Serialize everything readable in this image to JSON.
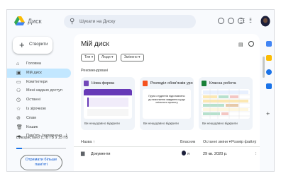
{
  "header": {
    "app_name": "Диск",
    "search_placeholder": "Шукати на Диску"
  },
  "sidebar": {
    "new_label": "Створити",
    "items": [
      {
        "label": "Головна",
        "icon": "home-icon",
        "glyph": "⌂"
      },
      {
        "label": "Мій диск",
        "icon": "my-drive-icon",
        "glyph": "▣"
      },
      {
        "label": "Комп'ютери",
        "icon": "computer-icon",
        "glyph": "▭"
      },
      {
        "label": "Мені надано доступ",
        "icon": "shared-icon",
        "glyph": "⚇"
      },
      {
        "label": "Останні",
        "icon": "clock-icon",
        "glyph": "◷"
      },
      {
        "label": "Із зірочкою",
        "icon": "star-icon",
        "glyph": "☆"
      },
      {
        "label": "Спам",
        "icon": "spam-icon",
        "glyph": "⊘"
      },
      {
        "label": "Кошик",
        "icon": "trash-icon",
        "glyph": "🗑"
      },
      {
        "label": "Пам'ять (заповнено…)",
        "icon": "cloud-icon",
        "glyph": "☁"
      }
    ],
    "storage_text": "Використано 1,78 ГБ з 15 ГБ",
    "storage_used": 0.12,
    "buy_label": "Отримати більше пам'яті"
  },
  "main": {
    "title": "Мій диск",
    "filters": [
      "Тип",
      "Люди",
      "Змінено"
    ],
    "suggested_label": "Рекомендовані",
    "cards": [
      {
        "name": "Нова форма",
        "sub": "Ви нещодавно відкрили",
        "color": "#7248b9"
      },
      {
        "name": "Розподіл обов'язків урок",
        "sub": "Ви нещодавно відкрили",
        "color": "#f4511e"
      },
      {
        "name": "Класна робота",
        "sub": "Ви нещодавно відкрили",
        "color": "#188038"
      }
    ],
    "card2_text": "Групи студентів підготовлено до виконання завдання щодо спільного проєкту",
    "list_headers": {
      "name": "Назва",
      "owner": "Власник",
      "modified": "Останні зміни",
      "size": "Розмір файлу"
    },
    "rows": [
      {
        "name": "Документи",
        "owner": "я",
        "modified": "29 кв. 2020 р."
      }
    ]
  },
  "colors": {
    "accent": "#0b57d0",
    "active_nav": "#c2e7ff",
    "panel": "#f8fafd"
  }
}
